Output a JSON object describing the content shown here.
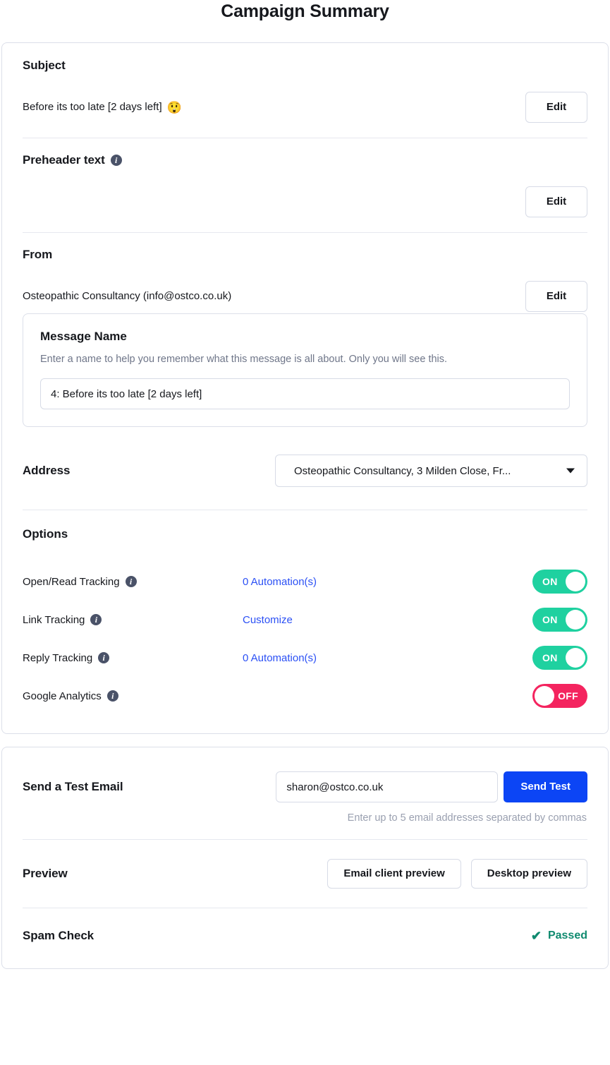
{
  "page": {
    "title": "Campaign Summary"
  },
  "subject": {
    "label": "Subject",
    "value": "Before its too late [2 days left]",
    "emoji": "😲",
    "edit_label": "Edit"
  },
  "preheader": {
    "label": "Preheader text",
    "info_icon": "info-icon",
    "value": "",
    "edit_label": "Edit"
  },
  "from": {
    "label": "From",
    "value": "Osteopathic Consultancy (info@ostco.co.uk)",
    "edit_label": "Edit"
  },
  "message_name": {
    "title": "Message Name",
    "help": "Enter a name to help you remember what this message is all about. Only you will see this.",
    "value": "4: Before its too late [2 days left]",
    "placeholder": "Message name"
  },
  "address": {
    "label": "Address",
    "selected": "Osteopathic Consultancy, 3 Milden Close, Fr...",
    "caret_icon": "chevron-down-icon"
  },
  "options": {
    "title": "Options",
    "items": [
      {
        "label": "Open/Read Tracking",
        "link": "0 Automation(s)",
        "state": "ON",
        "on": true
      },
      {
        "label": "Link Tracking",
        "link": "Customize",
        "state": "ON",
        "on": true
      },
      {
        "label": "Reply Tracking",
        "link": "0 Automation(s)",
        "state": "ON",
        "on": true
      },
      {
        "label": "Google Analytics",
        "link": "",
        "state": "OFF",
        "on": false
      }
    ]
  },
  "test_email": {
    "label": "Send a Test Email",
    "value": "sharon@ostco.co.uk",
    "placeholder": "Email address",
    "button_label": "Send Test",
    "hint": "Enter up to 5 email addresses separated by commas"
  },
  "preview": {
    "label": "Preview",
    "email_client_label": "Email client preview",
    "desktop_label": "Desktop preview"
  },
  "spam_check": {
    "label": "Spam Check",
    "status": "Passed",
    "icon": "check-icon"
  },
  "colors": {
    "accent_blue": "#0c45f5",
    "link_blue": "#2b50f5",
    "toggle_on": "#1fd1a0",
    "toggle_off": "#f4245f",
    "success_green": "#0f8a6f",
    "border": "#dcdfe9",
    "muted_text": "#6f7689"
  }
}
